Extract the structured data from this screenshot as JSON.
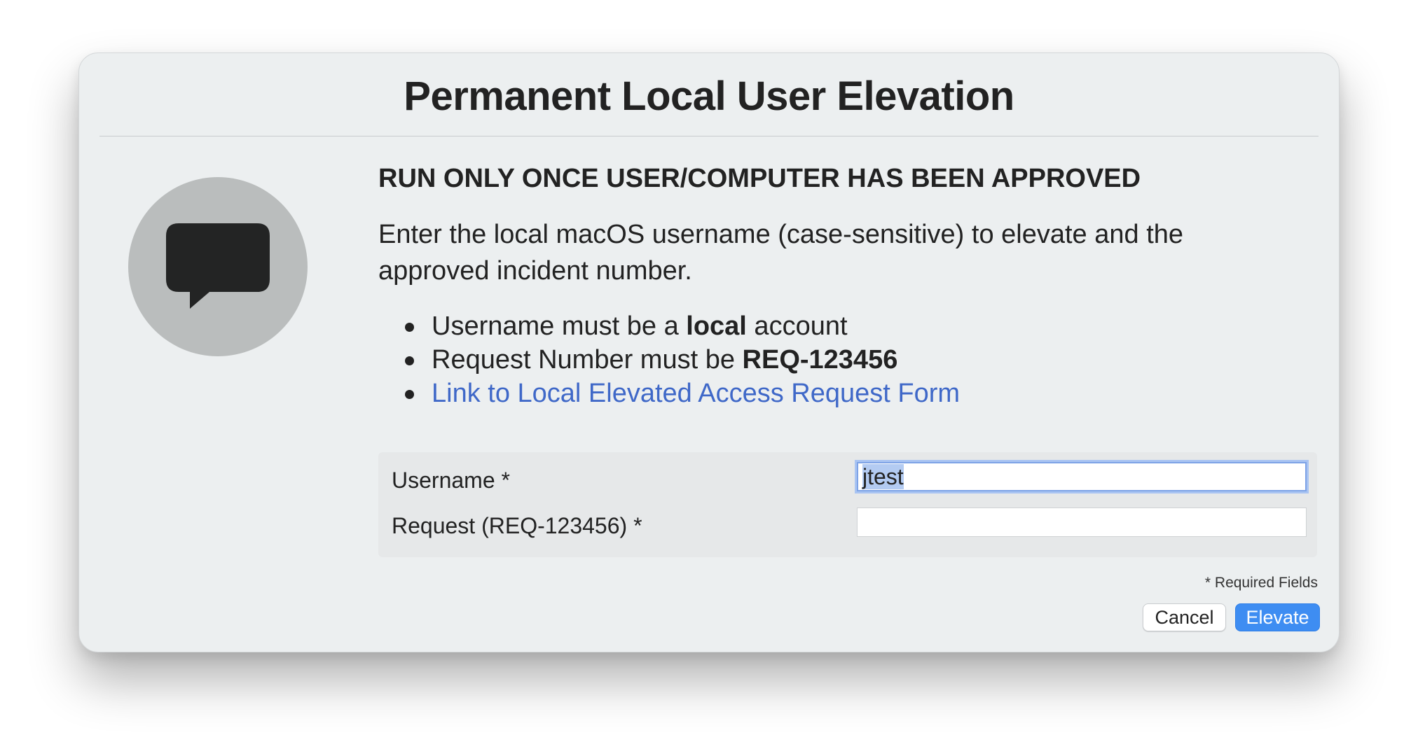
{
  "dialog": {
    "title": "Permanent Local User Elevation",
    "heading": "RUN ONLY ONCE USER/COMPUTER HAS BEEN APPROVED",
    "description": "Enter the local macOS username (case-sensitive) to elevate and the approved incident number.",
    "icon": "speech-bubble-icon",
    "bullets": {
      "username_prefix": "Username must be a ",
      "username_bold": "local",
      "username_suffix": " account",
      "request_prefix": "Request Number must be ",
      "request_bold": "REQ-123456",
      "link_text": "Link to Local Elevated Access Request Form"
    },
    "colors": {
      "link": "#3f68c8",
      "primary_button": "#3e8df2",
      "dialog_background": "#eceff0"
    }
  },
  "form": {
    "username_label": "Username *",
    "username_value": "jtest",
    "request_label": "Request (REQ-123456) *",
    "request_value": "",
    "required_note": "* Required Fields"
  },
  "buttons": {
    "cancel": "Cancel",
    "elevate": "Elevate"
  }
}
